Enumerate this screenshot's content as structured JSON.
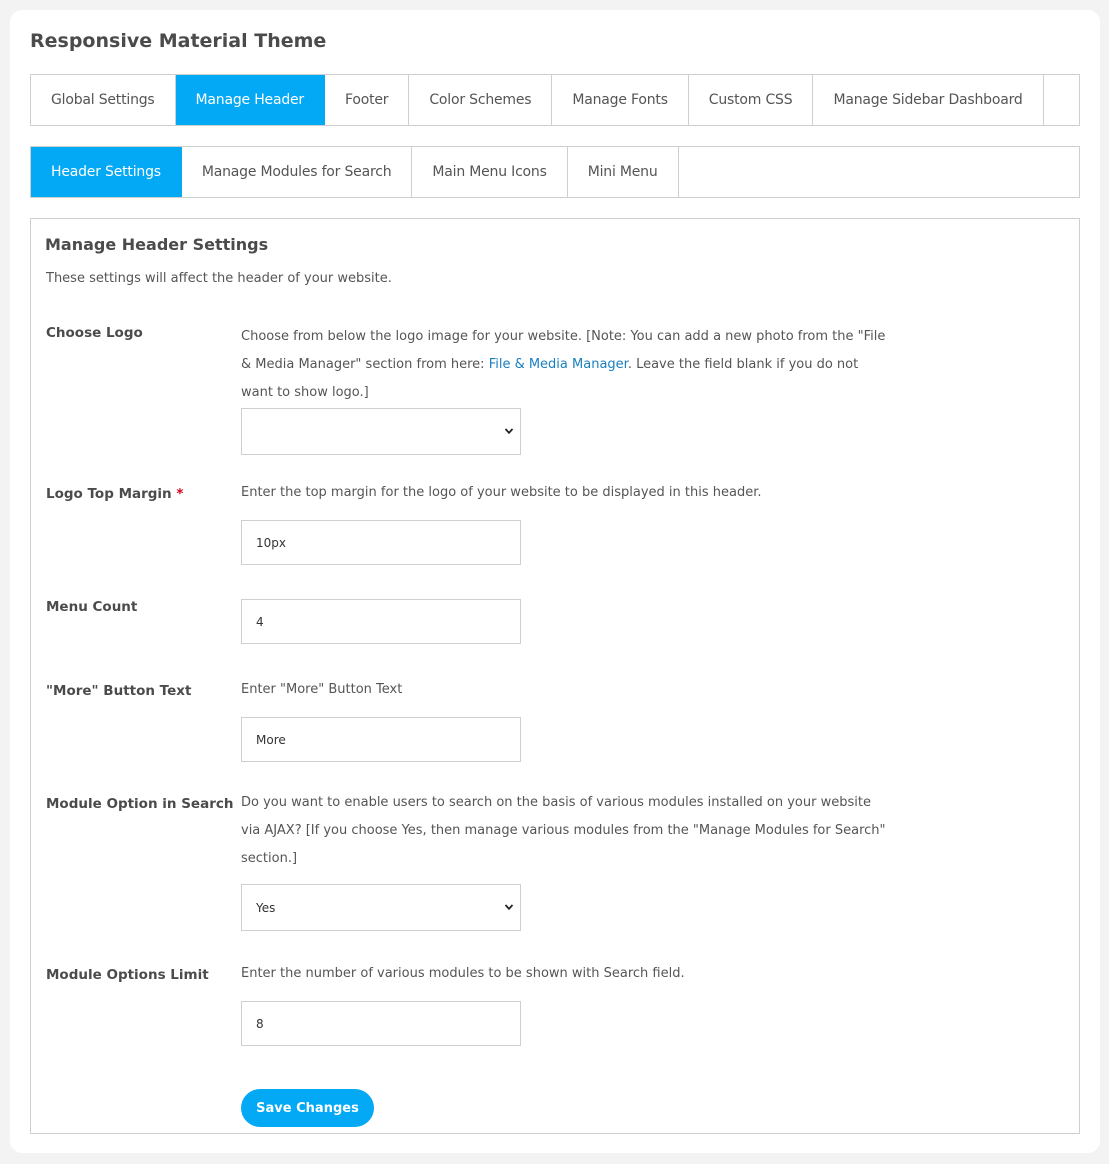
{
  "app": {
    "title": "Responsive Material Theme"
  },
  "main_tabs": [
    {
      "label": "Global Settings",
      "active": false
    },
    {
      "label": "Manage Header",
      "active": true
    },
    {
      "label": "Footer",
      "active": false
    },
    {
      "label": "Color Schemes",
      "active": false
    },
    {
      "label": "Manage Fonts",
      "active": false
    },
    {
      "label": "Custom CSS",
      "active": false
    },
    {
      "label": "Manage Sidebar Dashboard",
      "active": false
    }
  ],
  "sub_tabs": [
    {
      "label": "Header Settings",
      "active": true
    },
    {
      "label": "Manage Modules for Search",
      "active": false
    },
    {
      "label": "Main Menu Icons",
      "active": false
    },
    {
      "label": "Mini Menu",
      "active": false
    }
  ],
  "panel": {
    "title": "Manage Header Settings",
    "description": "These settings will affect the header of your website."
  },
  "fields": {
    "choose_logo": {
      "label": "Choose Logo",
      "hint_before_link": "Choose from below the logo image for your website. [Note: You can add a new photo from the \"File & Media Manager\" section from here: ",
      "hint_link": "File & Media Manager",
      "hint_after_link": ". Leave the field blank if you do not want to show logo.]",
      "value": ""
    },
    "logo_top_margin": {
      "label": "Logo Top Margin",
      "required_mark": "*",
      "hint": "Enter the top margin for the logo of your website to be displayed in this header.",
      "value": "10px"
    },
    "menu_count": {
      "label": "Menu Count",
      "value": "4"
    },
    "more_button_text": {
      "label": "\"More\" Button Text",
      "hint": "Enter \"More\" Button Text",
      "value": "More"
    },
    "module_option_in_search": {
      "label": "Module Option in Search",
      "hint": "Do you want to enable users to search on the basis of various modules installed on your website via AJAX? [If you choose Yes, then manage various modules from the \"Manage Modules for Search\" section.]",
      "value": "Yes"
    },
    "module_options_limit": {
      "label": "Module Options Limit",
      "hint": "Enter the number of various modules to be shown with Search field.",
      "value": "8"
    }
  },
  "actions": {
    "save_label": "Save Changes"
  },
  "colors": {
    "accent": "#03a9f4",
    "link": "#1a7fc1",
    "required": "#d0021b"
  }
}
